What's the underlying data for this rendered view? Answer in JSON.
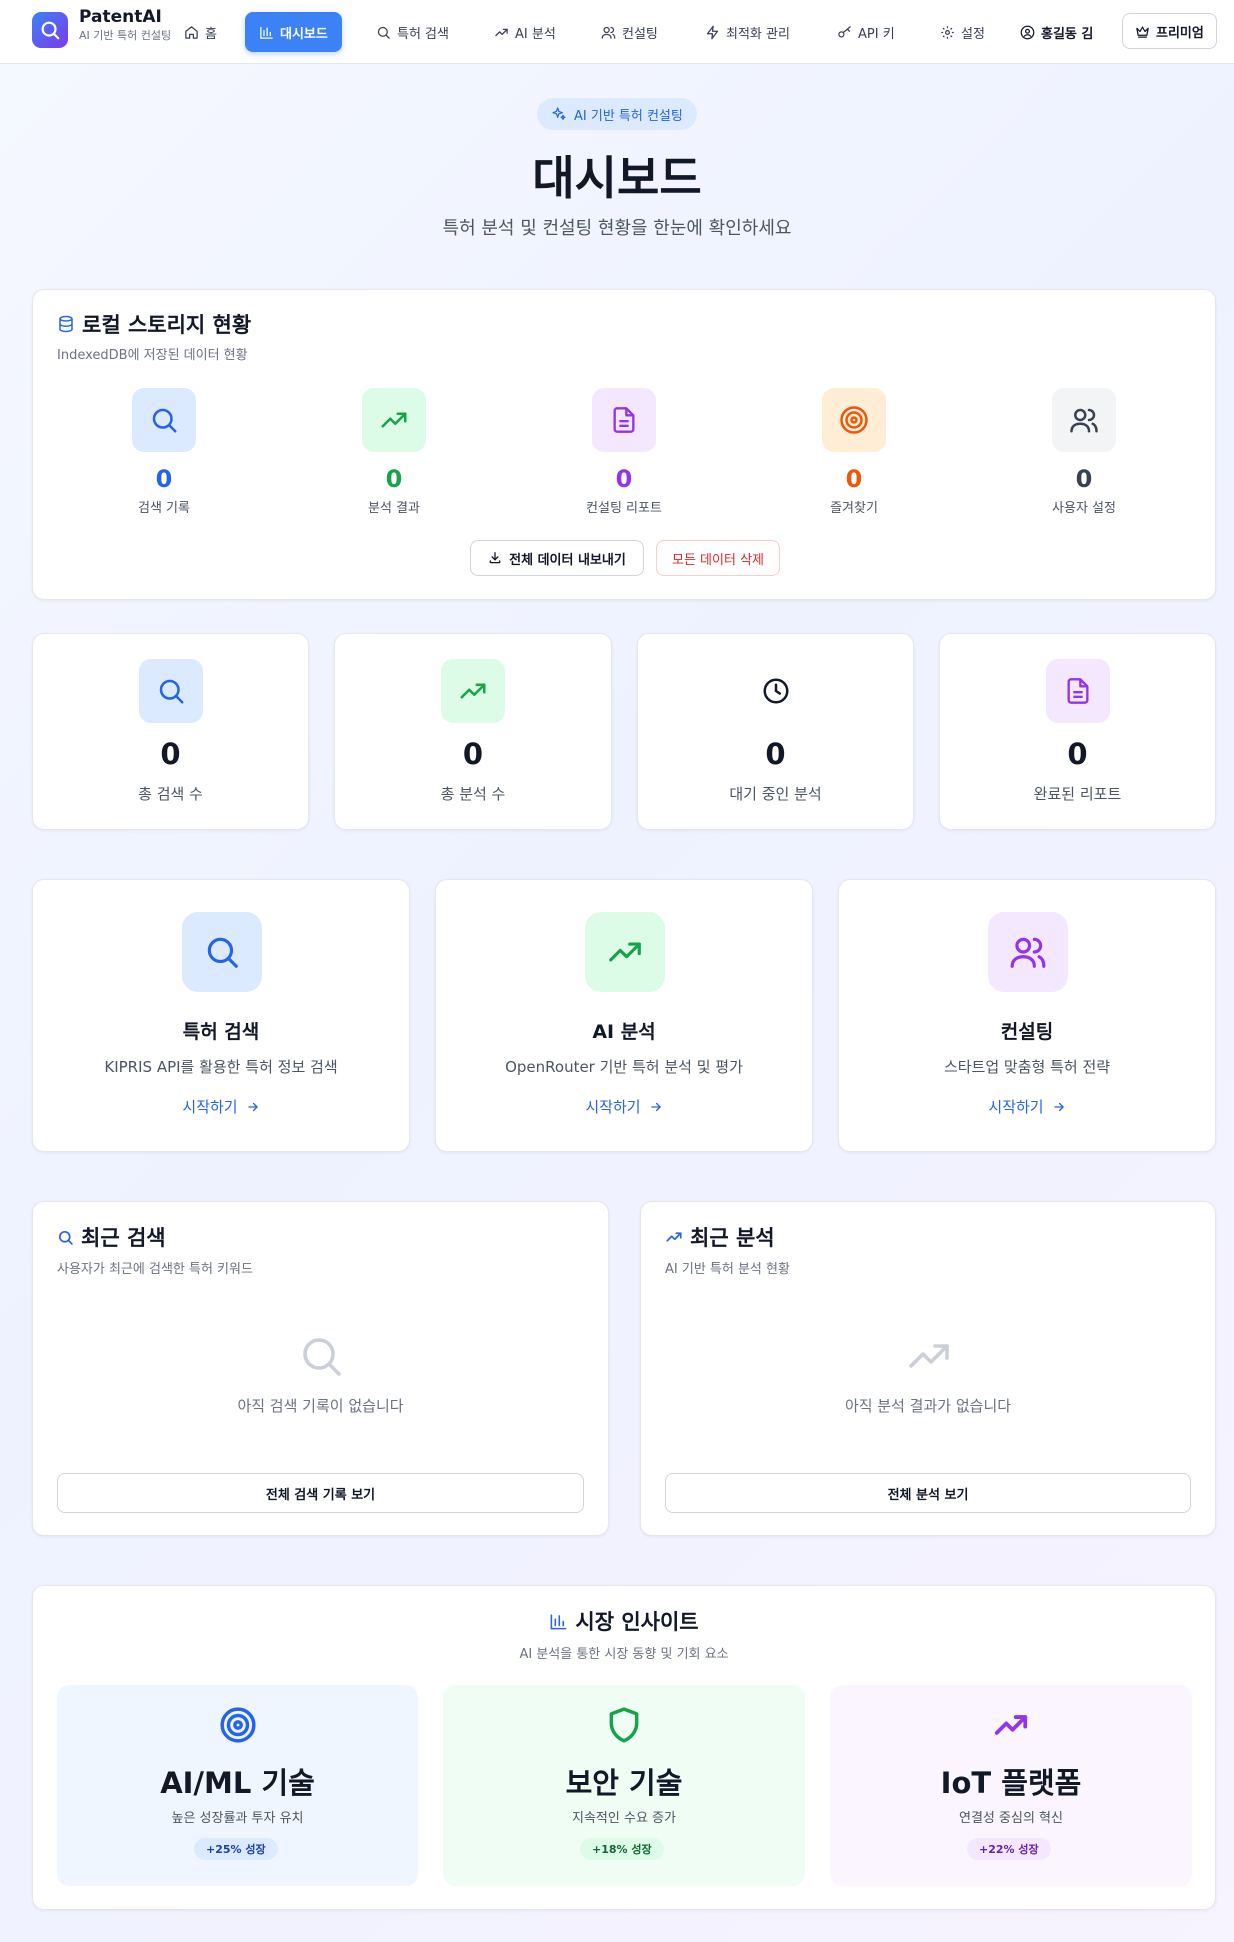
{
  "app": {
    "name": "PatentAI",
    "tagline": "AI 기반 특허 컨설팅"
  },
  "nav": {
    "items": [
      {
        "label": "홈",
        "icon": "home-icon",
        "active": false
      },
      {
        "label": "대시보드",
        "icon": "bar-chart-icon",
        "active": true
      },
      {
        "label": "특허 검색",
        "icon": "search-icon",
        "active": false
      },
      {
        "label": "AI 분석",
        "icon": "trending-up-icon",
        "active": false
      },
      {
        "label": "컨설팅",
        "icon": "users-icon",
        "active": false
      },
      {
        "label": "최적화 관리",
        "icon": "zap-icon",
        "active": false
      },
      {
        "label": "API 키",
        "icon": "key-icon",
        "active": false
      },
      {
        "label": "설정",
        "icon": "gear-icon",
        "active": false
      }
    ],
    "user": {
      "label": "홍길동 김",
      "icon": "user-circle-icon"
    },
    "premium": {
      "label": "프리미엄",
      "icon": "crown-icon"
    }
  },
  "hero": {
    "badge": "AI 기반 특허 컨설팅",
    "title": "대시보드",
    "subtitle": "특허 분석 및 컨설팅 현황을 한눈에 확인하세요"
  },
  "storage": {
    "title": "로컬 스토리지 현황",
    "subtitle": "IndexedDB에 저장된 데이터 현황",
    "stats": [
      {
        "value": "0",
        "label": "검색 기록",
        "icon": "search-icon",
        "color": "#2563eb",
        "bg": "#dbeafe"
      },
      {
        "value": "0",
        "label": "분석 결과",
        "icon": "trending-up-icon",
        "color": "#16a34a",
        "bg": "#dcfce7"
      },
      {
        "value": "0",
        "label": "컨설팅 리포트",
        "icon": "document-icon",
        "color": "#9333ea",
        "bg": "#f3e8ff"
      },
      {
        "value": "0",
        "label": "즐겨찾기",
        "icon": "target-icon",
        "color": "#ea580c",
        "bg": "#ffedd5"
      },
      {
        "value": "0",
        "label": "사용자 설정",
        "icon": "users-icon",
        "color": "#374151",
        "bg": "#f3f4f6"
      }
    ],
    "export_label": "전체 데이터 내보내기",
    "delete_label": "모든 데이터 삭제"
  },
  "summary": [
    {
      "value": "0",
      "label": "총 검색 수",
      "icon": "search-icon",
      "color": "#2563eb",
      "bg": "#dbeafe"
    },
    {
      "value": "0",
      "label": "총 분석 수",
      "icon": "trending-up-icon",
      "color": "#16a34a",
      "bg": "#dcfce7"
    },
    {
      "value": "0",
      "label": "대기 중인 분석",
      "icon": "clock-icon",
      "color": "#111827",
      "bg": "#ffffff"
    },
    {
      "value": "0",
      "label": "완료된 리포트",
      "icon": "document-icon",
      "color": "#9333ea",
      "bg": "#f3e8ff"
    }
  ],
  "features": [
    {
      "title": "특허 검색",
      "desc": "KIPRIS API를 활용한 특허 정보 검색",
      "link": "시작하기",
      "icon": "search-icon",
      "color": "#2563eb",
      "bg": "#dbeafe"
    },
    {
      "title": "AI 분석",
      "desc": "OpenRouter 기반 특허 분석 및 평가",
      "link": "시작하기",
      "icon": "trending-up-icon",
      "color": "#16a34a",
      "bg": "#dcfce7"
    },
    {
      "title": "컨설팅",
      "desc": "스타트업 맞춤형 특허 전략",
      "link": "시작하기",
      "icon": "users-icon",
      "color": "#9333ea",
      "bg": "#f3e8ff"
    }
  ],
  "recent_search": {
    "title": "최근 검색",
    "subtitle": "사용자가 최근에 검색한 특허 키워드",
    "empty": "아직 검색 기록이 없습니다",
    "button": "전체 검색 기록 보기"
  },
  "recent_analysis": {
    "title": "최근 분석",
    "subtitle": "AI 기반 특허 분석 현황",
    "empty": "아직 분석 결과가 없습니다",
    "button": "전체 분석 보기"
  },
  "insights": {
    "title": "시장 인사이트",
    "subtitle": "AI 분석을 통한 시장 동향 및 기회 요소",
    "cards": [
      {
        "title": "AI/ML 기술",
        "desc": "높은 성장률과 투자 유치",
        "badge": "+25% 성장",
        "icon": "target-icon",
        "color": "#2563eb",
        "bg": "#eff6ff",
        "badge_bg": "#dbeafe",
        "badge_color": "#1e40af"
      },
      {
        "title": "보안 기술",
        "desc": "지속적인 수요 증가",
        "badge": "+18% 성장",
        "icon": "shield-icon",
        "color": "#16a34a",
        "bg": "#f0fdf4",
        "badge_bg": "#dcfce7",
        "badge_color": "#166534"
      },
      {
        "title": "IoT 플랫폼",
        "desc": "연결성 중심의 혁신",
        "badge": "+22% 성장",
        "icon": "trending-up-icon",
        "color": "#9333ea",
        "bg": "#faf5ff",
        "badge_bg": "#f3e8ff",
        "badge_color": "#6b21a8"
      }
    ]
  }
}
